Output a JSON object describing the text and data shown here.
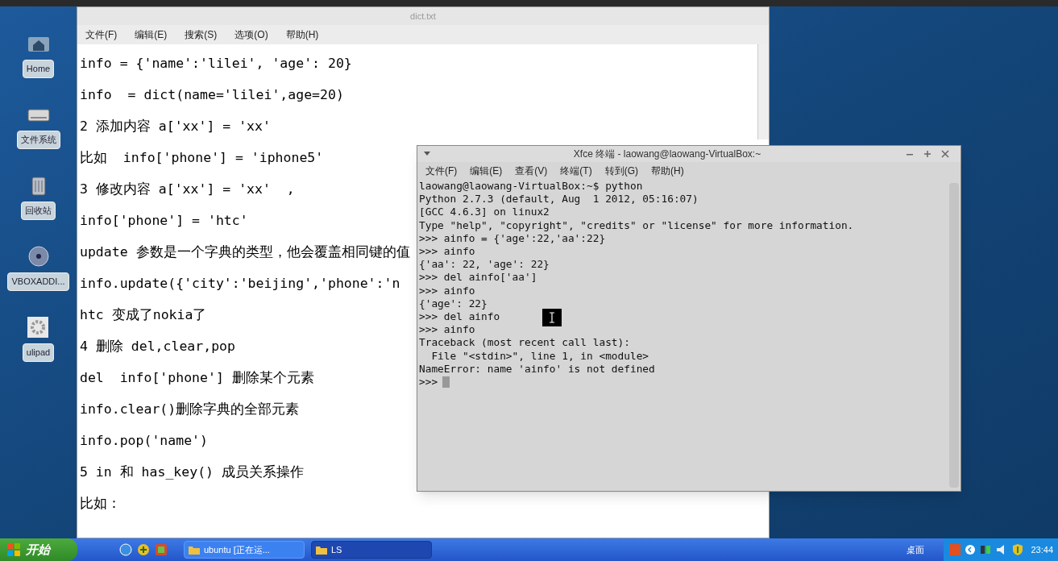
{
  "desktop_icons": [
    {
      "label": "Home",
      "kind": "home"
    },
    {
      "label": "文件系统",
      "kind": "drive"
    },
    {
      "label": "回收站",
      "kind": "trash"
    },
    {
      "label": "VBOXADDI...",
      "kind": "disc"
    },
    {
      "label": "ulipad",
      "kind": "gear"
    }
  ],
  "editor": {
    "title": "dict.txt",
    "menu": [
      "文件(F)",
      "编辑(E)",
      "搜索(S)",
      "选项(O)",
      "帮助(H)"
    ],
    "lines": [
      "info = {'name':'lilei', 'age': 20}",
      "info  = dict(name='lilei',age=20)",
      "2 添加内容 a['xx'] = 'xx'",
      "比如  info['phone'] = 'iphone5'",
      "3 修改内容 a['xx'] = 'xx'  ,",
      "info['phone'] = 'htc'",
      "update 参数是一个字典的类型，他会覆盖相同键的值",
      "info.update({'city':'beijing','phone':'n",
      "htc 变成了nokia了",
      "4 删除 del,clear,pop",
      "del  info['phone'] 删除某个元素",
      "info.clear()删除字典的全部元素",
      "info.pop('name')",
      "5 in 和 has_key() 成员关系操作",
      "比如："
    ]
  },
  "terminal": {
    "title": "Xfce 终端 - laowang@laowang-VirtualBox:~",
    "menu": [
      "文件(F)",
      "编辑(E)",
      "查看(V)",
      "终端(T)",
      "转到(G)",
      "帮助(H)"
    ],
    "lines": [
      "laowang@laowang-VirtualBox:~$ python",
      "Python 2.7.3 (default, Aug  1 2012, 05:16:07)",
      "[GCC 4.6.3] on linux2",
      "Type \"help\", \"copyright\", \"credits\" or \"license\" for more information.",
      ">>> ainfo = {'age':22,'aa':22}",
      ">>> ainfo",
      "{'aa': 22, 'age': 22}",
      ">>> del ainfo['aa']",
      ">>> ainfo",
      "{'age': 22}",
      ">>> del ainfo",
      ">>> ainfo",
      "Traceback (most recent call last):",
      "  File \"<stdin>\", line 1, in <module>",
      "NameError: name 'ainfo' is not defined"
    ],
    "prompt": ">>>"
  },
  "taskbar": {
    "start": "开始",
    "tasks": [
      {
        "label": "ubuntu [正在运...",
        "selected": false
      },
      {
        "label": "LS",
        "selected": true
      }
    ],
    "tray_text": "桌面",
    "clock": "23:44"
  }
}
